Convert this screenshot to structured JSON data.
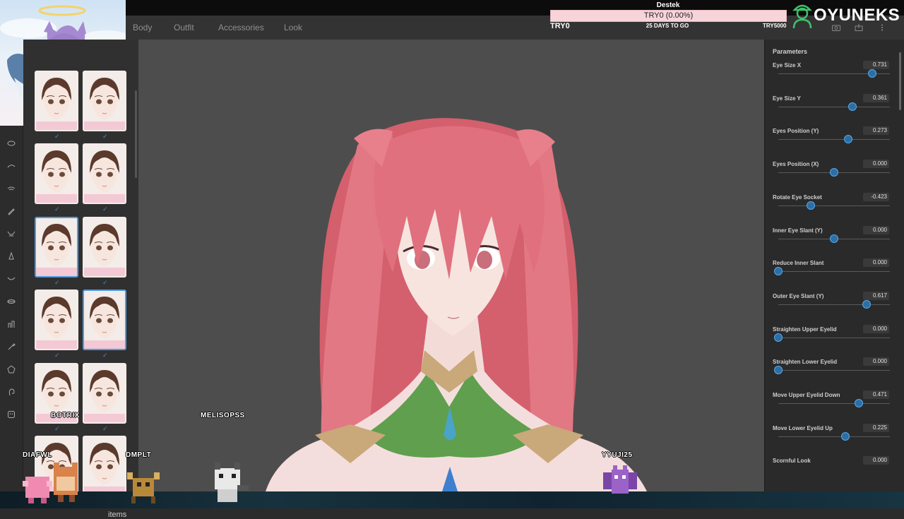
{
  "nav": {
    "tabs": [
      "Body",
      "Outfit",
      "Accessories",
      "Look"
    ]
  },
  "donation": {
    "title": "Destek",
    "progress_text": "TRY0 (0.00%)",
    "progress": 0.0,
    "left_label": "TRY0",
    "middle_label": "25 DAYS TO GO",
    "right_label": "TRY5000"
  },
  "brand": {
    "name": "OYUNEKS"
  },
  "left_tools": [
    "eye-shape-icon",
    "eyebrow-icon",
    "eyelash-icon",
    "pen-icon",
    "lash-spread-icon",
    "nose-icon",
    "mouth-icon",
    "lips-icon",
    "teeth-icon",
    "brush-icon",
    "face-shape-icon",
    "ear-icon",
    "face-icon"
  ],
  "presets": {
    "items_label": "items",
    "selected": [
      4,
      7
    ]
  },
  "params": {
    "title": "Parameters",
    "items": [
      {
        "label": "Eye Size X",
        "value": "0.731"
      },
      {
        "label": "Eye Size Y",
        "value": "0.361"
      },
      {
        "label": "Eyes Position (Y)",
        "value": "0.273"
      },
      {
        "label": "Eyes Position (X)",
        "value": "0.000"
      },
      {
        "label": "Rotate Eye Socket",
        "value": "-0.423"
      },
      {
        "label": "Inner Eye Slant (Y)",
        "value": "0.000"
      },
      {
        "label": "Reduce Inner Slant",
        "value": "0.000"
      },
      {
        "label": "Outer Eye Slant (Y)",
        "value": "0.617"
      },
      {
        "label": "Straighten Upper Eyelid",
        "value": "0.000"
      },
      {
        "label": "Straighten Lower Eyelid",
        "value": "0.000"
      },
      {
        "label": "Move Upper Eyelid Down",
        "value": "0.471"
      },
      {
        "label": "Move Lower Eyelid Up",
        "value": "0.225"
      },
      {
        "label": "Scornful Look",
        "value": "0.000"
      }
    ]
  },
  "chat_users": [
    "BOTRIX",
    "MELISOPSS",
    "DIAFWL",
    "DMPLT",
    "YYUJI25"
  ]
}
